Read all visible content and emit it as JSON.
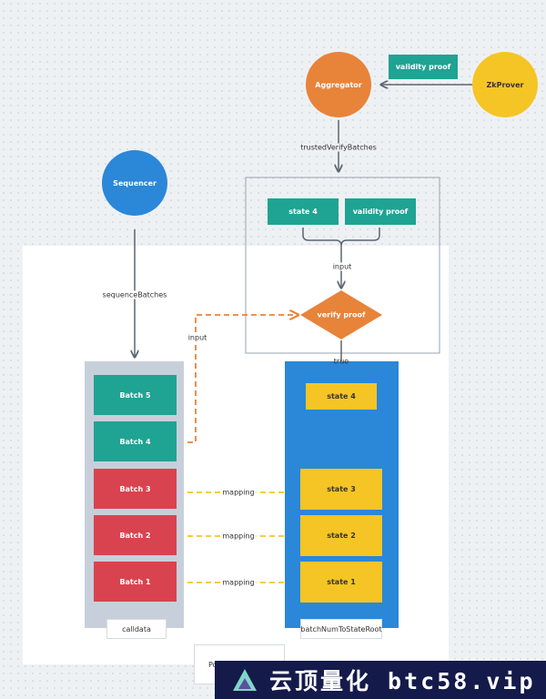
{
  "nodes": {
    "aggregator": "Aggregator",
    "zkprover": "ZkProver",
    "validity_proof_top": "validity proof",
    "sequencer": "Sequencer",
    "state4_input": "state 4",
    "validity_proof_input": "validity proof",
    "verify_proof": "verify proof"
  },
  "edges": {
    "trusted_verify": "trustedVerifyBatches",
    "input_brace": "input",
    "sequence_batches": "sequenceBatches",
    "input_dashed": "input",
    "true_label": "true",
    "mapping": [
      "mapping",
      "mapping",
      "mapping"
    ]
  },
  "calldata": {
    "label": "calldata",
    "batches": [
      "Batch 5",
      "Batch 4",
      "Batch 3",
      "Batch 2",
      "Batch 1"
    ]
  },
  "state_root": {
    "label": "batchNumToStateRoot",
    "states": [
      "state 4",
      "state 3",
      "state 2",
      "state 1"
    ]
  },
  "partial_box": "Po",
  "watermark": "云顶量化 btc58.vip",
  "colors": {
    "teal": "#1fa393",
    "red": "#d9434f",
    "yellow": "#f5c525",
    "orange": "#e8833a",
    "blue": "#2b87d8",
    "gray": "#c7d0da"
  }
}
